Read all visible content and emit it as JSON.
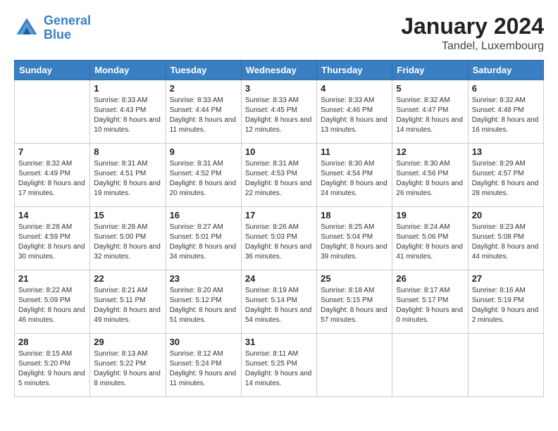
{
  "logo": {
    "text_general": "General",
    "text_blue": "Blue"
  },
  "title": "January 2024",
  "location": "Tandel, Luxembourg",
  "days_of_week": [
    "Sunday",
    "Monday",
    "Tuesday",
    "Wednesday",
    "Thursday",
    "Friday",
    "Saturday"
  ],
  "weeks": [
    [
      {
        "num": "",
        "sunrise": "",
        "sunset": "",
        "daylight": "",
        "empty": true
      },
      {
        "num": "1",
        "sunrise": "Sunrise: 8:33 AM",
        "sunset": "Sunset: 4:43 PM",
        "daylight": "Daylight: 8 hours and 10 minutes."
      },
      {
        "num": "2",
        "sunrise": "Sunrise: 8:33 AM",
        "sunset": "Sunset: 4:44 PM",
        "daylight": "Daylight: 8 hours and 11 minutes."
      },
      {
        "num": "3",
        "sunrise": "Sunrise: 8:33 AM",
        "sunset": "Sunset: 4:45 PM",
        "daylight": "Daylight: 8 hours and 12 minutes."
      },
      {
        "num": "4",
        "sunrise": "Sunrise: 8:33 AM",
        "sunset": "Sunset: 4:46 PM",
        "daylight": "Daylight: 8 hours and 13 minutes."
      },
      {
        "num": "5",
        "sunrise": "Sunrise: 8:32 AM",
        "sunset": "Sunset: 4:47 PM",
        "daylight": "Daylight: 8 hours and 14 minutes."
      },
      {
        "num": "6",
        "sunrise": "Sunrise: 8:32 AM",
        "sunset": "Sunset: 4:48 PM",
        "daylight": "Daylight: 8 hours and 16 minutes."
      }
    ],
    [
      {
        "num": "7",
        "sunrise": "Sunrise: 8:32 AM",
        "sunset": "Sunset: 4:49 PM",
        "daylight": "Daylight: 8 hours and 17 minutes.",
        "empty": false
      },
      {
        "num": "8",
        "sunrise": "Sunrise: 8:31 AM",
        "sunset": "Sunset: 4:51 PM",
        "daylight": "Daylight: 8 hours and 19 minutes."
      },
      {
        "num": "9",
        "sunrise": "Sunrise: 8:31 AM",
        "sunset": "Sunset: 4:52 PM",
        "daylight": "Daylight: 8 hours and 20 minutes."
      },
      {
        "num": "10",
        "sunrise": "Sunrise: 8:31 AM",
        "sunset": "Sunset: 4:53 PM",
        "daylight": "Daylight: 8 hours and 22 minutes."
      },
      {
        "num": "11",
        "sunrise": "Sunrise: 8:30 AM",
        "sunset": "Sunset: 4:54 PM",
        "daylight": "Daylight: 8 hours and 24 minutes."
      },
      {
        "num": "12",
        "sunrise": "Sunrise: 8:30 AM",
        "sunset": "Sunset: 4:56 PM",
        "daylight": "Daylight: 8 hours and 26 minutes."
      },
      {
        "num": "13",
        "sunrise": "Sunrise: 8:29 AM",
        "sunset": "Sunset: 4:57 PM",
        "daylight": "Daylight: 8 hours and 28 minutes."
      }
    ],
    [
      {
        "num": "14",
        "sunrise": "Sunrise: 8:28 AM",
        "sunset": "Sunset: 4:59 PM",
        "daylight": "Daylight: 8 hours and 30 minutes.",
        "empty": false
      },
      {
        "num": "15",
        "sunrise": "Sunrise: 8:28 AM",
        "sunset": "Sunset: 5:00 PM",
        "daylight": "Daylight: 8 hours and 32 minutes."
      },
      {
        "num": "16",
        "sunrise": "Sunrise: 8:27 AM",
        "sunset": "Sunset: 5:01 PM",
        "daylight": "Daylight: 8 hours and 34 minutes."
      },
      {
        "num": "17",
        "sunrise": "Sunrise: 8:26 AM",
        "sunset": "Sunset: 5:03 PM",
        "daylight": "Daylight: 8 hours and 36 minutes."
      },
      {
        "num": "18",
        "sunrise": "Sunrise: 8:25 AM",
        "sunset": "Sunset: 5:04 PM",
        "daylight": "Daylight: 8 hours and 39 minutes."
      },
      {
        "num": "19",
        "sunrise": "Sunrise: 8:24 AM",
        "sunset": "Sunset: 5:06 PM",
        "daylight": "Daylight: 8 hours and 41 minutes."
      },
      {
        "num": "20",
        "sunrise": "Sunrise: 8:23 AM",
        "sunset": "Sunset: 5:08 PM",
        "daylight": "Daylight: 8 hours and 44 minutes."
      }
    ],
    [
      {
        "num": "21",
        "sunrise": "Sunrise: 8:22 AM",
        "sunset": "Sunset: 5:09 PM",
        "daylight": "Daylight: 8 hours and 46 minutes.",
        "empty": false
      },
      {
        "num": "22",
        "sunrise": "Sunrise: 8:21 AM",
        "sunset": "Sunset: 5:11 PM",
        "daylight": "Daylight: 8 hours and 49 minutes."
      },
      {
        "num": "23",
        "sunrise": "Sunrise: 8:20 AM",
        "sunset": "Sunset: 5:12 PM",
        "daylight": "Daylight: 8 hours and 51 minutes."
      },
      {
        "num": "24",
        "sunrise": "Sunrise: 8:19 AM",
        "sunset": "Sunset: 5:14 PM",
        "daylight": "Daylight: 8 hours and 54 minutes."
      },
      {
        "num": "25",
        "sunrise": "Sunrise: 8:18 AM",
        "sunset": "Sunset: 5:15 PM",
        "daylight": "Daylight: 8 hours and 57 minutes."
      },
      {
        "num": "26",
        "sunrise": "Sunrise: 8:17 AM",
        "sunset": "Sunset: 5:17 PM",
        "daylight": "Daylight: 9 hours and 0 minutes."
      },
      {
        "num": "27",
        "sunrise": "Sunrise: 8:16 AM",
        "sunset": "Sunset: 5:19 PM",
        "daylight": "Daylight: 9 hours and 2 minutes."
      }
    ],
    [
      {
        "num": "28",
        "sunrise": "Sunrise: 8:15 AM",
        "sunset": "Sunset: 5:20 PM",
        "daylight": "Daylight: 9 hours and 5 minutes.",
        "empty": false
      },
      {
        "num": "29",
        "sunrise": "Sunrise: 8:13 AM",
        "sunset": "Sunset: 5:22 PM",
        "daylight": "Daylight: 9 hours and 8 minutes."
      },
      {
        "num": "30",
        "sunrise": "Sunrise: 8:12 AM",
        "sunset": "Sunset: 5:24 PM",
        "daylight": "Daylight: 9 hours and 11 minutes."
      },
      {
        "num": "31",
        "sunrise": "Sunrise: 8:11 AM",
        "sunset": "Sunset: 5:25 PM",
        "daylight": "Daylight: 9 hours and 14 minutes."
      },
      {
        "num": "",
        "sunrise": "",
        "sunset": "",
        "daylight": "",
        "empty": true
      },
      {
        "num": "",
        "sunrise": "",
        "sunset": "",
        "daylight": "",
        "empty": true
      },
      {
        "num": "",
        "sunrise": "",
        "sunset": "",
        "daylight": "",
        "empty": true
      }
    ]
  ]
}
